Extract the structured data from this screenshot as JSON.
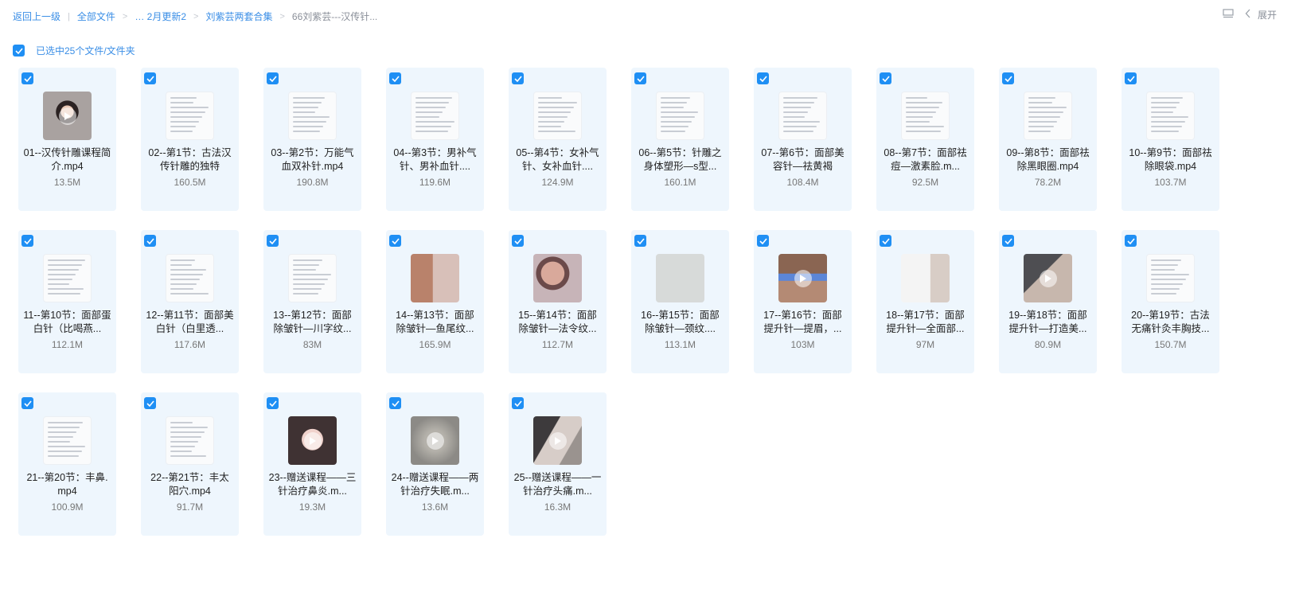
{
  "breadcrumb": {
    "back": "返回上一级",
    "all_files": "全部文件",
    "ellipsis_item": "… 2月更新2",
    "folder": "刘紫芸两套合集",
    "current": "66刘紫芸---汉传针..."
  },
  "topright": {
    "expand_label": "展开"
  },
  "selection": {
    "text": "已选中25个文件/文件夹"
  },
  "files": [
    {
      "name": "01--汉传针雕课程简介.mp4",
      "size": "13.5M",
      "thumb": "photo-face",
      "play": true
    },
    {
      "name": "02--第1节：古法汉传针雕的独特",
      "size": "160.5M",
      "thumb": "doc",
      "play": false
    },
    {
      "name": "03--第2节：万能气血双补针.mp4",
      "size": "190.8M",
      "thumb": "doc",
      "play": false
    },
    {
      "name": "04--第3节：男补气针、男补血针....",
      "size": "119.6M",
      "thumb": "doc",
      "play": false
    },
    {
      "name": "05--第4节：女补气针、女补血针....",
      "size": "124.9M",
      "thumb": "doc",
      "play": false
    },
    {
      "name": "06--第5节：针雕之身体塑形—s型...",
      "size": "160.1M",
      "thumb": "doc",
      "play": false
    },
    {
      "name": "07--第6节：面部美容针—祛黄褐",
      "size": "108.4M",
      "thumb": "doc",
      "play": false
    },
    {
      "name": "08--第7节：面部祛痘—激素脸.m...",
      "size": "92.5M",
      "thumb": "doc",
      "play": false
    },
    {
      "name": "09--第8节：面部祛除黑眼圈.mp4",
      "size": "78.2M",
      "thumb": "doc",
      "play": false
    },
    {
      "name": "10--第9节：面部祛除眼袋.mp4",
      "size": "103.7M",
      "thumb": "doc",
      "play": false
    },
    {
      "name": "11--第10节：面部蛋白针（比喝燕...",
      "size": "112.1M",
      "thumb": "doc",
      "play": false
    },
    {
      "name": "12--第11节：面部美白针（白里透...",
      "size": "117.6M",
      "thumb": "doc",
      "play": false
    },
    {
      "name": "13--第12节：面部除皱针—川字纹...",
      "size": "83M",
      "thumb": "doc",
      "play": false
    },
    {
      "name": "14--第13节：面部除皱针—鱼尾纹...",
      "size": "165.9M",
      "thumb": "photo-pink",
      "play": false
    },
    {
      "name": "15--第14节：面部除皱针—法令纹...",
      "size": "112.7M",
      "thumb": "photo-pink2",
      "play": false
    },
    {
      "name": "16--第15节：面部除皱针—颈纹....",
      "size": "113.1M",
      "thumb": "photo-grey",
      "play": false
    },
    {
      "name": "17--第16节：面部提升针—提眉，...",
      "size": "103M",
      "thumb": "photo-eyes",
      "play": true
    },
    {
      "name": "18--第17节：面部提升针—全面部...",
      "size": "97M",
      "thumb": "photo-pale",
      "play": false
    },
    {
      "name": "19--第18节：面部提升针—打造美...",
      "size": "80.9M",
      "thumb": "photo-dark",
      "play": true
    },
    {
      "name": "20--第19节：古法无痛针灸丰胸技...",
      "size": "150.7M",
      "thumb": "doc",
      "play": false
    },
    {
      "name": "21--第20节：丰鼻.mp4",
      "size": "100.9M",
      "thumb": "doc",
      "play": false
    },
    {
      "name": "22--第21节：丰太阳穴.mp4",
      "size": "91.7M",
      "thumb": "doc",
      "play": false
    },
    {
      "name": "23--赠送课程——三针治疗鼻炎.m...",
      "size": "19.3M",
      "thumb": "photo-woman",
      "play": true
    },
    {
      "name": "24--赠送课程——两针治疗失眠.m...",
      "size": "13.6M",
      "thumb": "photo-blur",
      "play": true
    },
    {
      "name": "25--赠送课程——一针治疗头痛.m...",
      "size": "16.3M",
      "thumb": "photo-hand",
      "play": true
    }
  ]
}
